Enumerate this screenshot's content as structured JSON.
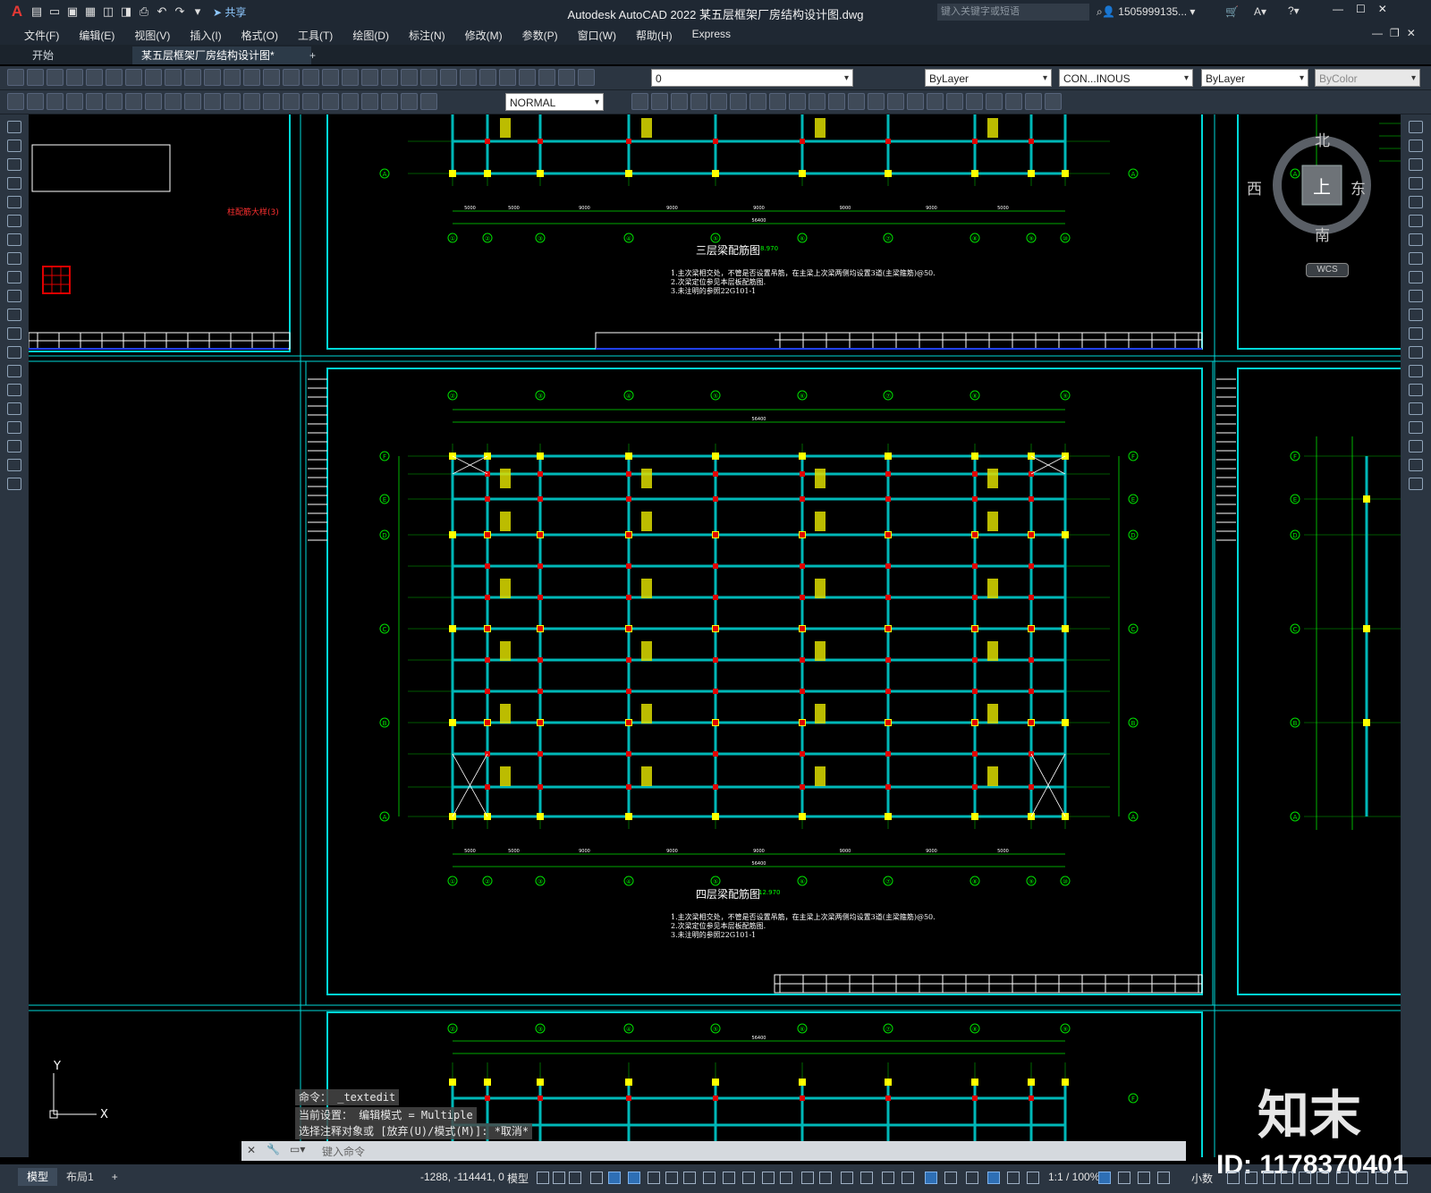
{
  "app": {
    "title": "Autodesk AutoCAD 2022    某五层框架厂房结构设计图.dwg",
    "share_label": "共享",
    "search_placeholder": "键入关键字或短语",
    "user_name": "1505999135..."
  },
  "menu": [
    "文件(F)",
    "编辑(E)",
    "视图(V)",
    "插入(I)",
    "格式(O)",
    "工具(T)",
    "绘图(D)",
    "标注(N)",
    "修改(M)",
    "参数(P)",
    "窗口(W)",
    "帮助(H)",
    "Express"
  ],
  "tabs": {
    "start": "开始",
    "active": "某五层框架厂房结构设计图*",
    "add": "+"
  },
  "toolbar": {
    "layer_value": "0",
    "color_value": "ByLayer",
    "linetype_value": "CON...INOUS",
    "lineweight_value": "ByLayer",
    "plotstyle_value": "ByColor",
    "dimstyle_value": "NORMAL"
  },
  "viewcube": {
    "north": "北",
    "south": "南",
    "east": "东",
    "west": "西",
    "top": "上",
    "wcs": "WCS"
  },
  "drawing": {
    "plan3_title": "三层梁配筋图",
    "plan3_elev": "8.970",
    "plan4_title": "四层梁配筋图",
    "plan4_elev": "12.970",
    "notes": [
      "1.主次梁相交处，不管是否设置吊筋，在主梁上次梁两侧均设置3道(主梁箍筋)@50.",
      "2.次梁定位参见本层板配筋图.",
      "3.未注明的参照22G101-1"
    ],
    "axes_top": [
      "②",
      "③",
      "④",
      "⑤",
      "⑥",
      "⑦",
      "⑧",
      "⑨"
    ],
    "axes_bottom": [
      "①",
      "②",
      "③",
      "④",
      "⑤",
      "⑥",
      "⑦",
      "⑧",
      "⑨",
      "⑩"
    ],
    "axes_side": [
      "F",
      "E",
      "D",
      "C",
      "B",
      "A"
    ],
    "detail_label": "柱配筋大样(3)",
    "dims_bottom": [
      "5000",
      "5000",
      "9000",
      "9000",
      "9000",
      "9000",
      "9000",
      "5000"
    ],
    "dim_total": "56400"
  },
  "command": {
    "line1": "命令： _textedit",
    "line2": "当前设置： 编辑模式 = Multiple",
    "line3": "选择注释对象或 [放弃(U)/模式(M)]: *取消*",
    "placeholder": "键入命令"
  },
  "status": {
    "model_tab": "模型",
    "layout_tab": "布局1",
    "coords": "-1288, -114441, 0",
    "model": "模型",
    "scale": "1:1 / 100%",
    "units": "小数"
  },
  "watermark": {
    "brand": "知末",
    "id": "ID: 1178370401"
  },
  "colors": {
    "frame": "#00e5e5",
    "grid": "#00c800",
    "beam": "#00c0c0",
    "column": "#ffff00",
    "joint": "#e00000",
    "text": "#ffff00",
    "chrome": "#2b3541"
  }
}
